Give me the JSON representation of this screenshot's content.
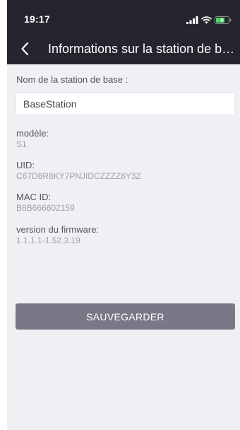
{
  "status_bar": {
    "time": "19:17",
    "icons": [
      "signal-icon",
      "wifi-icon",
      "battery-charging-icon"
    ]
  },
  "nav": {
    "back_icon": "chevron-left-icon",
    "title": "Informations sur la station de base"
  },
  "form": {
    "name_label": "Nom de la station de base :",
    "name_value": "BaseStation"
  },
  "info": {
    "model_label": "modèle:",
    "model_value": "S1",
    "uid_label": "UID:",
    "uid_value": "C67D8R8KY7PNJIDCZZZZ8Y3Z",
    "mac_label": "MAC ID:",
    "mac_value": "B6B666602159",
    "firmware_label": "version du firmware:",
    "firmware_value": "1.1.1.1-1.52.3.19"
  },
  "actions": {
    "save_label": "SAUVEGARDER"
  },
  "colors": {
    "header_bg": "#25252f",
    "content_bg": "#f0f0f4",
    "button_bg": "#787886",
    "battery_accent": "#4cd964"
  }
}
